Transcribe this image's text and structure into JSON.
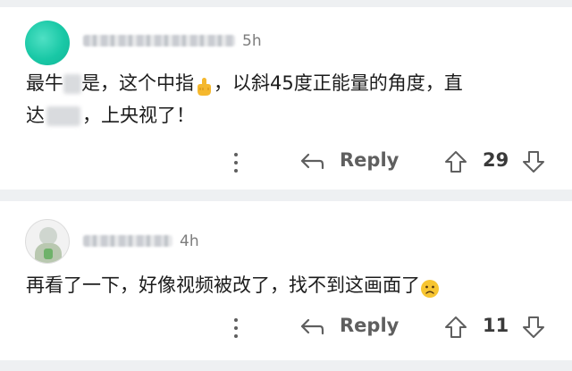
{
  "comments": [
    {
      "username": "blurred",
      "time": "5h",
      "text_part1": "最牛",
      "text_part2": "是，这个中指",
      "text_part3": "，以斜45度正能量的角度，直",
      "text_line2_part1": "达",
      "text_line2_part2": "，上央视了！",
      "reply_label": "Reply",
      "votes": "29"
    },
    {
      "username": "blurred",
      "time": "4h",
      "text": "再看了一下，好像视频被改了，找不到这画面了",
      "reply_label": "Reply",
      "votes": "11"
    }
  ],
  "icons": {
    "avatar1": "teal-avatar",
    "avatar2": "figure-avatar",
    "emoji1": "middle-finger-emoji",
    "emoji2": "worried-face-emoji",
    "more": "more-dots-icon",
    "reply": "reply-arrow-icon",
    "upvote": "upvote-arrow-icon",
    "downvote": "downvote-arrow-icon"
  },
  "colors": {
    "background": "#eef0f2",
    "card": "#ffffff",
    "text": "#1c1c1c",
    "meta": "#7d7d7d",
    "action": "#5f5f5f"
  }
}
